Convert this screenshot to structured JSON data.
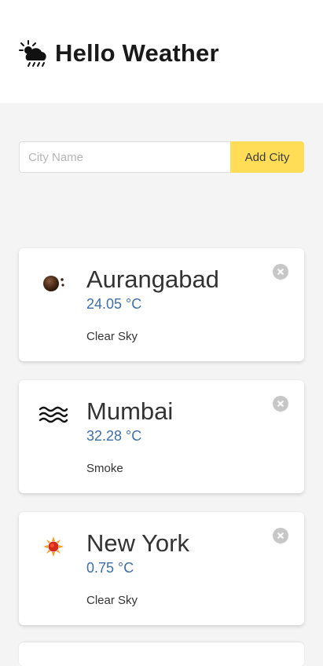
{
  "header": {
    "title": "Hello Weather",
    "logo_icon": "cloud-rain-sun-icon"
  },
  "form": {
    "placeholder": "City Name",
    "value": "",
    "add_label": "Add City"
  },
  "colors": {
    "accent_button": "#ffdd57",
    "temperature_text": "#3e6fa7",
    "background": "#f4f4f4"
  },
  "cities": [
    {
      "name": "Aurangabad",
      "temp": "24.05 °C",
      "description": "Clear Sky",
      "icon": "moon-icon"
    },
    {
      "name": "Mumbai",
      "temp": "32.28 °C",
      "description": "Smoke",
      "icon": "fog-icon"
    },
    {
      "name": "New York",
      "temp": "0.75 °C",
      "description": "Clear Sky",
      "icon": "sun-icon"
    }
  ]
}
